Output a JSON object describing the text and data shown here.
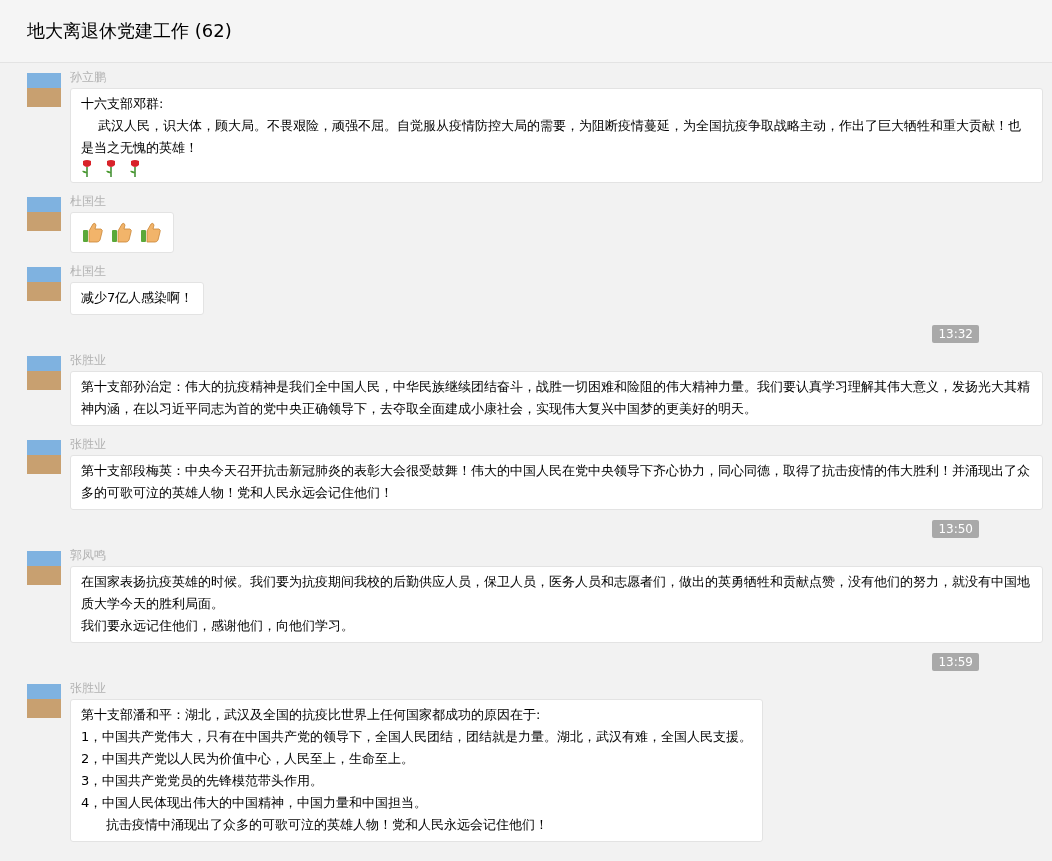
{
  "header": {
    "title": "地大离退休党建工作 (62)"
  },
  "items": [
    {
      "kind": "message",
      "sender": "孙立鹏",
      "lines": [
        "十六支部邓群:",
        "    武汉人民，识大体，顾大局。不畏艰险，顽强不屈。自觉服从疫情防控大局的需要，为阻断疫情蔓延，为全国抗疫争取战略主动，作出了巨大牺牲和重大贡献！也是当之无愧的英雄！"
      ],
      "icons": [
        {
          "kind": "rose"
        },
        {
          "kind": "rose"
        },
        {
          "kind": "rose"
        }
      ]
    },
    {
      "kind": "message",
      "sender": "杜国生",
      "icons": [
        {
          "kind": "thumbs"
        },
        {
          "kind": "thumbs"
        },
        {
          "kind": "thumbs"
        }
      ]
    },
    {
      "kind": "message",
      "sender": "杜国生",
      "lines": [
        "减少7亿人感染啊！"
      ]
    },
    {
      "kind": "time",
      "text": "13:32"
    },
    {
      "kind": "message",
      "sender": "张胜业",
      "lines": [
        "第十支部孙治定：伟大的抗疫精神是我们全中国人民，中华民族继续团结奋斗，战胜一切困难和险阻的伟大精神力量。我们要认真学习理解其伟大意义，发扬光大其精神内涵，在以习近平同志为首的党中央正确领导下，去夺取全面建成小康社会，实现伟大复兴中国梦的更美好的明天。"
      ]
    },
    {
      "kind": "message",
      "sender": "张胜业",
      "lines": [
        "第十支部段梅英：中央今天召开抗击新冠肺炎的表彰大会很受鼓舞！伟大的中国人民在党中央领导下齐心协力，同心同德，取得了抗击疫情的伟大胜利！并涌现出了众多的可歌可泣的英雄人物！党和人民永远会记住他们！"
      ]
    },
    {
      "kind": "time",
      "text": "13:50"
    },
    {
      "kind": "message",
      "sender": "郭凤鸣",
      "lines": [
        "在国家表扬抗疫英雄的时候。我们要为抗疫期间我校的后勤供应人员，保卫人员，医务人员和志愿者们，做出的英勇牺牲和贡献点赞，没有他们的努力，就没有中国地质大学今天的胜利局面。",
        "我们要永远记住他们，感谢他们，向他们学习。"
      ]
    },
    {
      "kind": "time",
      "text": "13:59"
    },
    {
      "kind": "message",
      "sender": "张胜业",
      "lines": [
        "第十支部潘和平：湖北，武汉及全国的抗疫比世界上任何国家都成功的原因在于:",
        "1，中国共产党伟大，只有在中国共产党的领导下，全国人民团结，团结就是力量。湖北，武汉有难，全国人民支援。",
        "2，中国共产党以人民为价值中心，人民至上，生命至上。",
        "3，中国共产党党员的先锋模范带头作用。",
        "4，中国人民体现出伟大的中国精神，中国力量和中国担当。",
        "      抗击疫情中涌现出了众多的可歌可泣的英雄人物！党和人民永远会记住他们！"
      ]
    }
  ]
}
